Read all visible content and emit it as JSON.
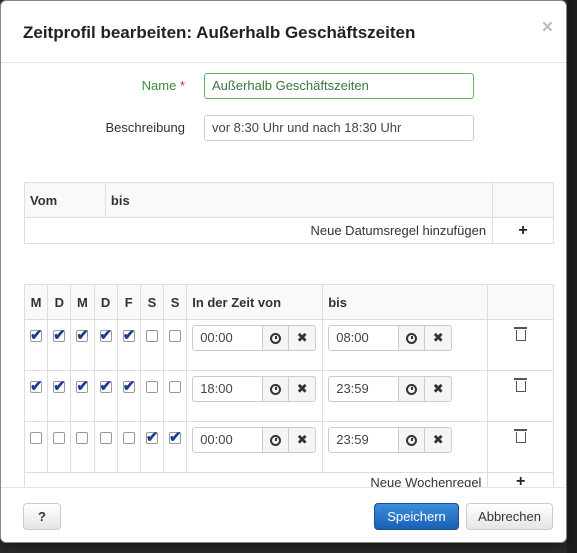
{
  "dialog": {
    "title": "Zeitprofil bearbeiten: Außerhalb Geschäftszeiten",
    "close": "×"
  },
  "form": {
    "name_label": "Name",
    "required_mark": "*",
    "name_value": "Außerhalb Geschäftszeiten",
    "desc_label": "Beschreibung",
    "desc_value": "vor 8:30 Uhr und nach 18:30 Uhr"
  },
  "date_rules": {
    "headers": [
      "Vom",
      "bis"
    ],
    "add_label": "Neue Datumsregel hinzufügen",
    "add_icon": "+"
  },
  "week_rules": {
    "day_headers": [
      "M",
      "D",
      "M",
      "D",
      "F",
      "S",
      "S"
    ],
    "from_header": "In der Zeit von",
    "to_header": "bis",
    "rows": [
      {
        "days": [
          true,
          true,
          true,
          true,
          true,
          false,
          false
        ],
        "from": "00:00",
        "to": "08:00"
      },
      {
        "days": [
          true,
          true,
          true,
          true,
          true,
          false,
          false
        ],
        "from": "18:00",
        "to": "23:59"
      },
      {
        "days": [
          false,
          false,
          false,
          false,
          false,
          true,
          true
        ],
        "from": "00:00",
        "to": "23:59"
      }
    ],
    "add_label": "Neue Wochenregel",
    "add_icon": "+",
    "clear_icon": "✖"
  },
  "footer": {
    "help": "?",
    "save": "Speichern",
    "cancel": "Abbrechen"
  },
  "colors": {
    "primary": "#1a5fb4",
    "success": "#3c8d3c",
    "check": "#1a3d8f"
  }
}
